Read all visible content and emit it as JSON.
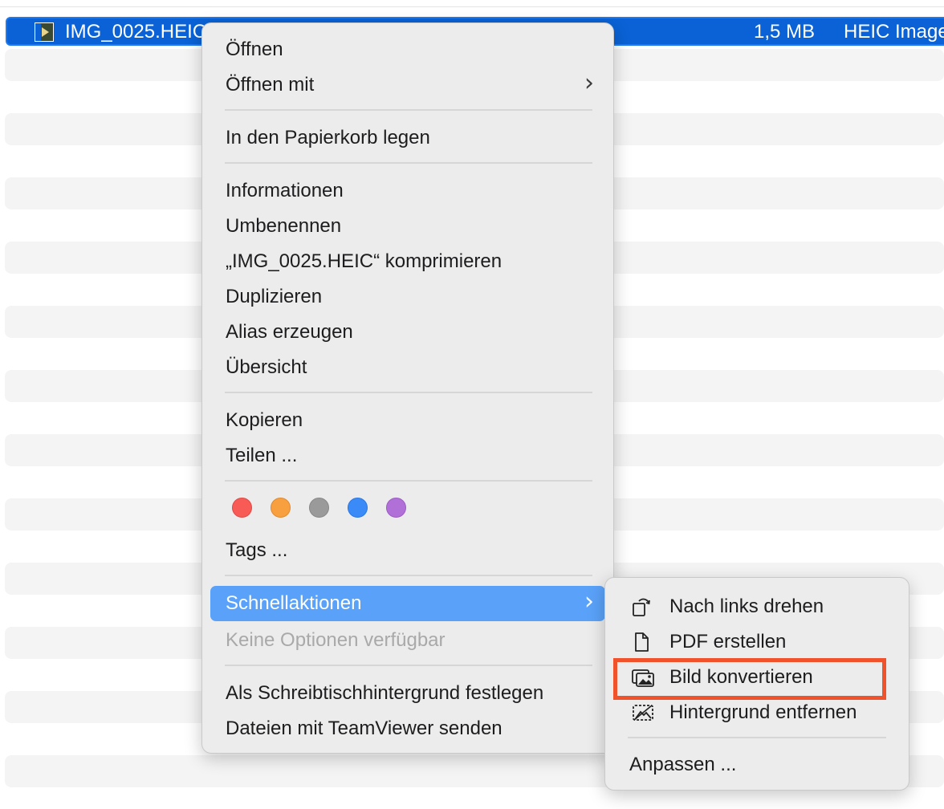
{
  "file_row": {
    "name": "IMG_0025.HEIC",
    "size": "1,5 MB",
    "kind": "HEIC Image"
  },
  "context_menu": {
    "items": [
      {
        "label": "Öffnen"
      },
      {
        "label": "Öffnen mit"
      },
      {
        "label": "In den Papierkorb legen"
      },
      {
        "label": "Informationen"
      },
      {
        "label": "Umbenennen"
      },
      {
        "label": "„IMG_0025.HEIC“ komprimieren"
      },
      {
        "label": "Duplizieren"
      },
      {
        "label": "Alias erzeugen"
      },
      {
        "label": "Übersicht"
      },
      {
        "label": "Kopieren"
      },
      {
        "label": "Teilen ..."
      },
      {
        "label": "Tags ..."
      },
      {
        "label": "Schnellaktionen"
      },
      {
        "label": "Keine Optionen verfügbar"
      },
      {
        "label": "Als Schreibtischhintergrund festlegen"
      },
      {
        "label": "Dateien mit TeamViewer senden"
      }
    ],
    "tag_colors": [
      {
        "name": "red",
        "fill": "#f85a55",
        "stroke": "#e04a45"
      },
      {
        "name": "orange",
        "fill": "#f8a040",
        "stroke": "#e08a30"
      },
      {
        "name": "gray",
        "fill": "#9a9a9a",
        "stroke": "#888888"
      },
      {
        "name": "blue",
        "fill": "#3a8af8",
        "stroke": "#2a78e6"
      },
      {
        "name": "purple",
        "fill": "#b070d8",
        "stroke": "#9c5cc6"
      }
    ],
    "highlight_color": "#5aa2f9"
  },
  "quick_actions_menu": {
    "items": [
      {
        "label": "Nach links drehen",
        "icon": "rotate-left-icon"
      },
      {
        "label": "PDF erstellen",
        "icon": "document-icon"
      },
      {
        "label": "Bild konvertieren",
        "icon": "photos-icon"
      },
      {
        "label": "Hintergrund entfernen",
        "icon": "remove-background-icon"
      },
      {
        "label": "Anpassen ..."
      }
    ]
  },
  "annotation_color": "#f0522b"
}
